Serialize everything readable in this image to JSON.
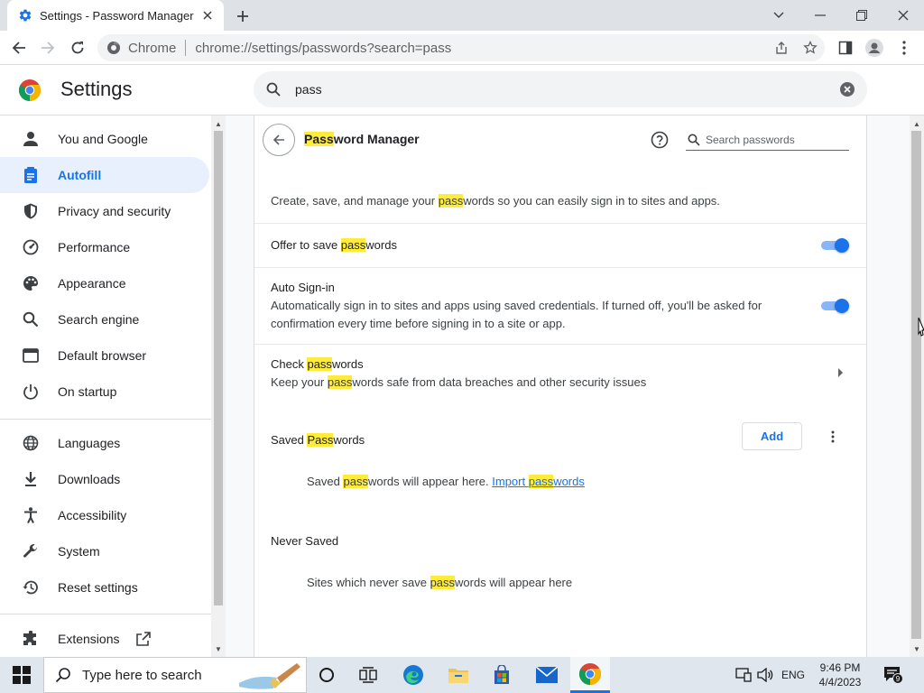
{
  "window": {
    "tab_title": "Settings - Password Manager"
  },
  "toolbar": {
    "omnibox_chip": "Chrome",
    "url": "chrome://settings/passwords?search=pass"
  },
  "header": {
    "title": "Settings",
    "search_value": "pass"
  },
  "sidebar": {
    "items": [
      {
        "label": "You and Google",
        "icon": "person-icon"
      },
      {
        "label": "Autofill",
        "icon": "autofill-icon",
        "active": true
      },
      {
        "label": "Privacy and security",
        "icon": "shield-icon"
      },
      {
        "label": "Performance",
        "icon": "speedometer-icon"
      },
      {
        "label": "Appearance",
        "icon": "palette-icon"
      },
      {
        "label": "Search engine",
        "icon": "search-icon"
      },
      {
        "label": "Default browser",
        "icon": "browser-window-icon"
      },
      {
        "label": "On startup",
        "icon": "power-icon"
      },
      {
        "label": "Languages",
        "icon": "globe-icon"
      },
      {
        "label": "Downloads",
        "icon": "download-icon"
      },
      {
        "label": "Accessibility",
        "icon": "accessibility-icon"
      },
      {
        "label": "System",
        "icon": "wrench-icon"
      },
      {
        "label": "Reset settings",
        "icon": "history-icon"
      },
      {
        "label": "Extensions",
        "icon": "puzzle-icon"
      }
    ]
  },
  "password_manager": {
    "title_highlight": "Pass",
    "title_rest": "word Manager",
    "search_placeholder": "Search passwords",
    "description": {
      "before": "Create, save, and manage your ",
      "highlight": "pass",
      "after": "words so you can easily sign in to sites and apps."
    },
    "offer_to_save": {
      "before": "Offer to save ",
      "highlight": "pass",
      "after": "words",
      "enabled": true
    },
    "auto_signin": {
      "title": "Auto Sign-in",
      "line1": "Automatically sign in to sites and apps using saved credentials. If turned off, you'll be asked for",
      "line2": "confirmation every time before signing in to a site or app.",
      "enabled": true
    },
    "check_passwords": {
      "title_before": "Check ",
      "title_highlight": "pass",
      "title_after": "words",
      "sub_before": "Keep your ",
      "sub_highlight": "pass",
      "sub_after": "words safe from data breaches and other security issues"
    },
    "saved_passwords": {
      "title_before": "Saved ",
      "title_highlight": "Pass",
      "title_after": "words",
      "add_label": "Add",
      "empty_before": "Saved ",
      "empty_highlight": "pass",
      "empty_after": "words will appear here. ",
      "import_before": "Import ",
      "import_highlight": "pass",
      "import_after": "words"
    },
    "never_saved": {
      "title": "Never Saved",
      "empty_before": "Sites which never save ",
      "empty_highlight": "pass",
      "empty_after": "words will appear here"
    }
  },
  "taskbar": {
    "search_placeholder": "Type here to search",
    "language": "ENG",
    "time": "9:46 PM",
    "date": "4/4/2023",
    "notification_count": "9"
  },
  "colors": {
    "accent": "#1a73e8",
    "highlight": "#ffeb3b",
    "active_nav_bg": "#e8f0fe"
  }
}
